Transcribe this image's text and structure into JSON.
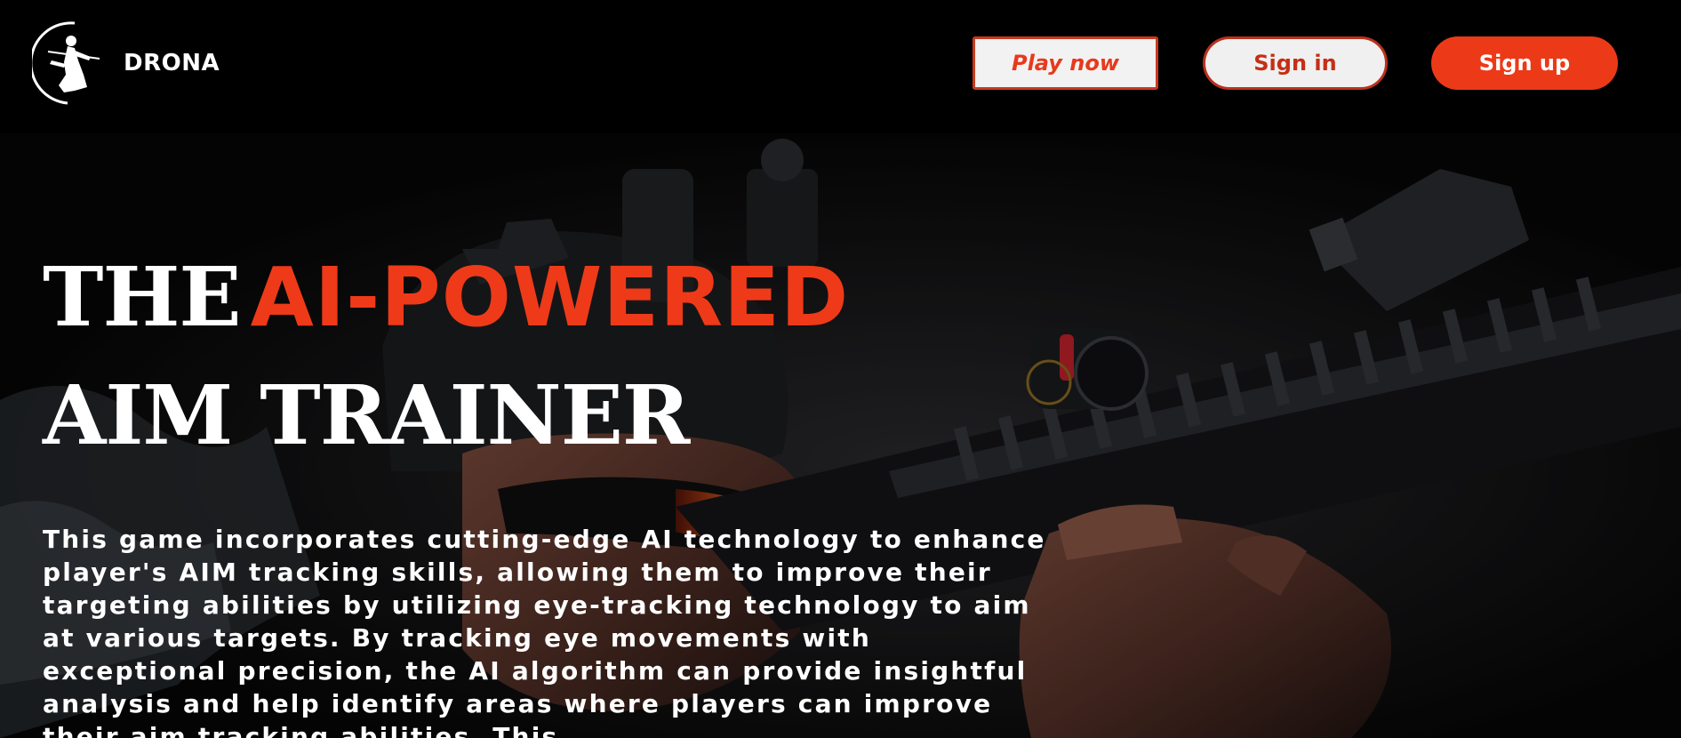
{
  "header": {
    "brand": "DRONA",
    "logo_icon": "archer-silhouette-icon",
    "buttons": {
      "play_label": "Play now",
      "signin_label": "Sign in",
      "signup_label": "Sign up"
    }
  },
  "hero": {
    "headline": {
      "word_the": "THE",
      "accent": "AI-POWERED",
      "line2": "AIM TRAINER"
    },
    "description": "This game incorporates cutting-edge AI technology to enhance player's AIM tracking skills, allowing them to improve their targeting abilities by utilizing eye-tracking technology to aim at various targets. By tracking eye movements with exceptional precision, the AI algorithm can provide insightful analysis and help identify areas where players can improve their aim tracking abilities. This",
    "background_image": "soldier-aiming-rifle-photo"
  },
  "colors": {
    "accent": "#ee3a18",
    "nav_background": "#000000",
    "text": "#ffffff"
  }
}
